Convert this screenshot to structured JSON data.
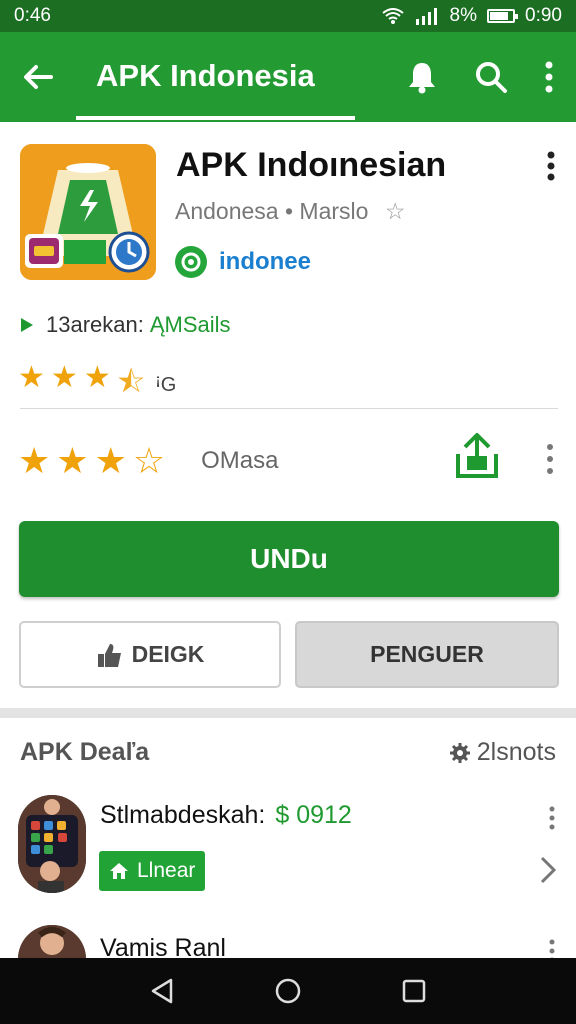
{
  "status": {
    "time": "0:46",
    "battery_text": "8%",
    "clock_right": "0:90",
    "battery_level": 0.8
  },
  "appbar": {
    "title": "APK Indonesia",
    "icons": [
      "back-arrow-icon",
      "bell-icon",
      "search-icon",
      "more-vert-icon"
    ]
  },
  "app": {
    "name": "APK Indoınesian",
    "subtitle": "Andonesa • Marslo",
    "developer": "indonee",
    "info_prefix": "13arekan:",
    "info_accent": "ĄMSails",
    "rating1_tail": "ꜟG",
    "rating1": 3.5,
    "rating2_label": "OMasa",
    "rating2": 3.5
  },
  "buttons": {
    "install": "UNDu",
    "left": "DEIGK",
    "right": "PENGUER"
  },
  "section": {
    "title": "APK Deaľa",
    "right": "2lsnots"
  },
  "list": [
    {
      "name": "Stlmabdeskah:",
      "price": "$ 0912",
      "tag": "Llnear"
    },
    {
      "name": "Vamis Ranl"
    }
  ],
  "colors": {
    "brand": "#239a32",
    "status_bar": "#1b6e22",
    "accent": "#1f9a30",
    "star": "#f0a20a",
    "link": "#1b7fd0"
  }
}
